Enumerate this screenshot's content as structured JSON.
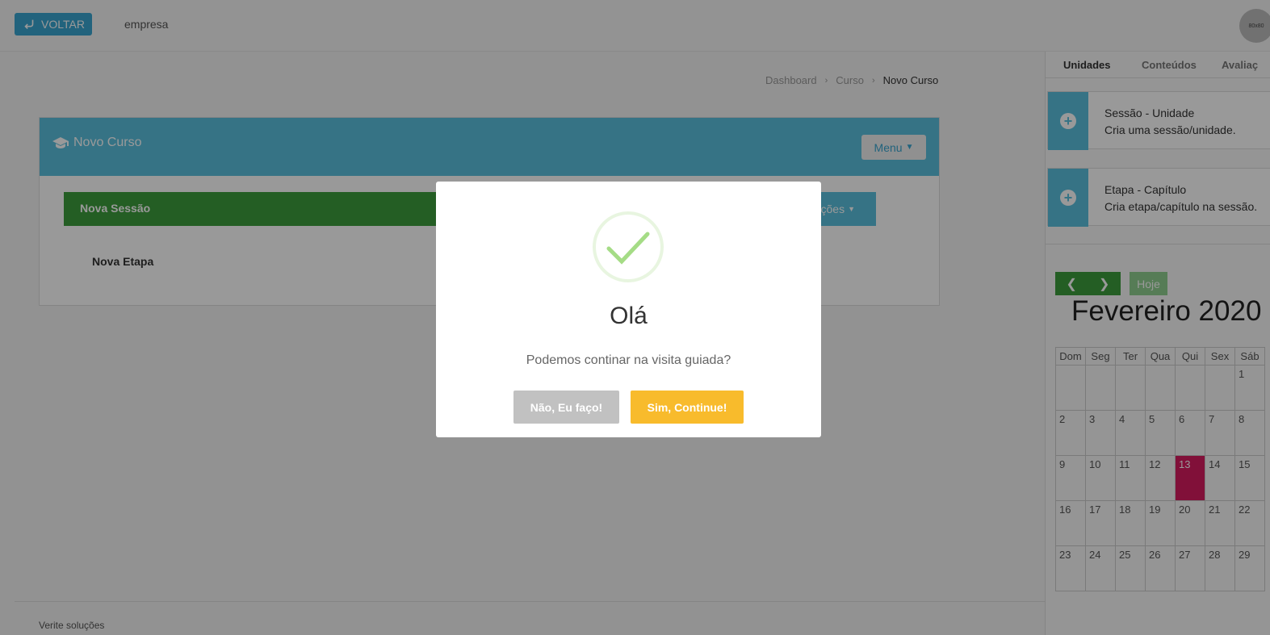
{
  "topbar": {
    "back_label": "VOLTAR",
    "company": "empresa",
    "avatar_text": "80x80"
  },
  "breadcrumb": [
    "Dashboard",
    "Curso",
    "Novo Curso"
  ],
  "panel": {
    "title": "Novo Curso",
    "menu_label": "Menu",
    "session_label": "Nova Sessão",
    "actions_label": "ções",
    "etapa_label": "Nova Etapa"
  },
  "footer": {
    "text": "Verite soluções"
  },
  "sidebar": {
    "tabs": [
      "Unidades",
      "Conteúdos",
      "Avaliaç"
    ],
    "cards": [
      {
        "title": "Sessão - Unidade",
        "desc": "Cria uma sessão/unidade."
      },
      {
        "title": "Etapa - Capítulo",
        "desc": "Cria etapa/capítulo na sessão."
      }
    ],
    "calendar": {
      "today_label": "Hoje",
      "title": "Fevereiro 2020",
      "weekdays": [
        "Dom",
        "Seg",
        "Ter",
        "Qua",
        "Qui",
        "Sex",
        "Sáb"
      ],
      "weeks": [
        [
          "",
          "",
          "",
          "",
          "",
          "",
          "1"
        ],
        [
          "2",
          "3",
          "4",
          "5",
          "6",
          "7",
          "8"
        ],
        [
          "9",
          "10",
          "11",
          "12",
          "13",
          "14",
          "15"
        ],
        [
          "16",
          "17",
          "18",
          "19",
          "20",
          "21",
          "22"
        ],
        [
          "23",
          "24",
          "25",
          "26",
          "27",
          "28",
          "29"
        ]
      ],
      "highlight_day": "13",
      "highlight_color": "#d81b60"
    }
  },
  "modal": {
    "title": "Olá",
    "text": "Podemos continar na visita guiada?",
    "no_label": "Não, Eu faço!",
    "yes_label": "Sim, Continue!"
  },
  "colors": {
    "primary": "#5bc0de",
    "success": "#3c9d3c",
    "warning": "#f8bb2c"
  }
}
